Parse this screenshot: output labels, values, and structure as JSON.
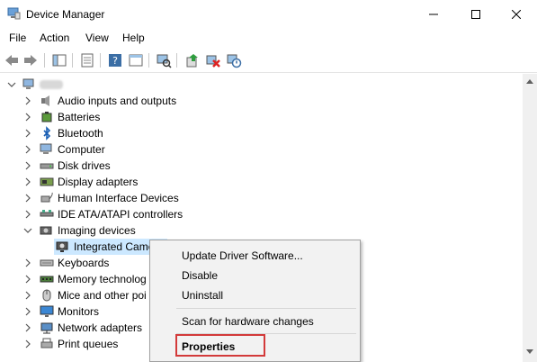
{
  "window": {
    "title": "Device Manager"
  },
  "menu": [
    "File",
    "Action",
    "View",
    "Help"
  ],
  "tree": {
    "categories": [
      {
        "label": "Audio inputs and outputs",
        "icon": "speaker-icon",
        "expanded": false
      },
      {
        "label": "Batteries",
        "icon": "battery-icon",
        "expanded": false
      },
      {
        "label": "Bluetooth",
        "icon": "bluetooth-icon",
        "expanded": false
      },
      {
        "label": "Computer",
        "icon": "computer-icon",
        "expanded": false
      },
      {
        "label": "Disk drives",
        "icon": "disk-drive-icon",
        "expanded": false
      },
      {
        "label": "Display adapters",
        "icon": "display-adapter-icon",
        "expanded": false
      },
      {
        "label": "Human Interface Devices",
        "icon": "hid-icon",
        "expanded": false
      },
      {
        "label": "IDE ATA/ATAPI controllers",
        "icon": "ide-controller-icon",
        "expanded": false
      },
      {
        "label": "Imaging devices",
        "icon": "camera-icon",
        "expanded": true
      },
      {
        "label": "Integrated Came",
        "icon": "webcam-icon",
        "child": true
      },
      {
        "label": "Keyboards",
        "icon": "keyboard-icon",
        "expanded": false
      },
      {
        "label": "Memory technolog",
        "icon": "memory-icon",
        "expanded": false
      },
      {
        "label": "Mice and other poi",
        "icon": "mouse-icon",
        "expanded": false
      },
      {
        "label": "Monitors",
        "icon": "monitor-icon",
        "expanded": false
      },
      {
        "label": "Network adapters",
        "icon": "network-icon",
        "expanded": false
      },
      {
        "label": "Print queues",
        "icon": "printer-icon",
        "expanded": false
      }
    ]
  },
  "context_menu": {
    "items": [
      {
        "label": "Update Driver Software...",
        "bold": false
      },
      {
        "label": "Disable",
        "bold": false
      },
      {
        "label": "Uninstall",
        "bold": false
      },
      {
        "label": "Scan for hardware changes",
        "bold": false
      },
      {
        "label": "Properties",
        "bold": true
      }
    ]
  },
  "colors": {
    "selection": "#cce8ff",
    "highlight_box": "#d33a3a",
    "menu_bg": "#f2f2f2"
  }
}
